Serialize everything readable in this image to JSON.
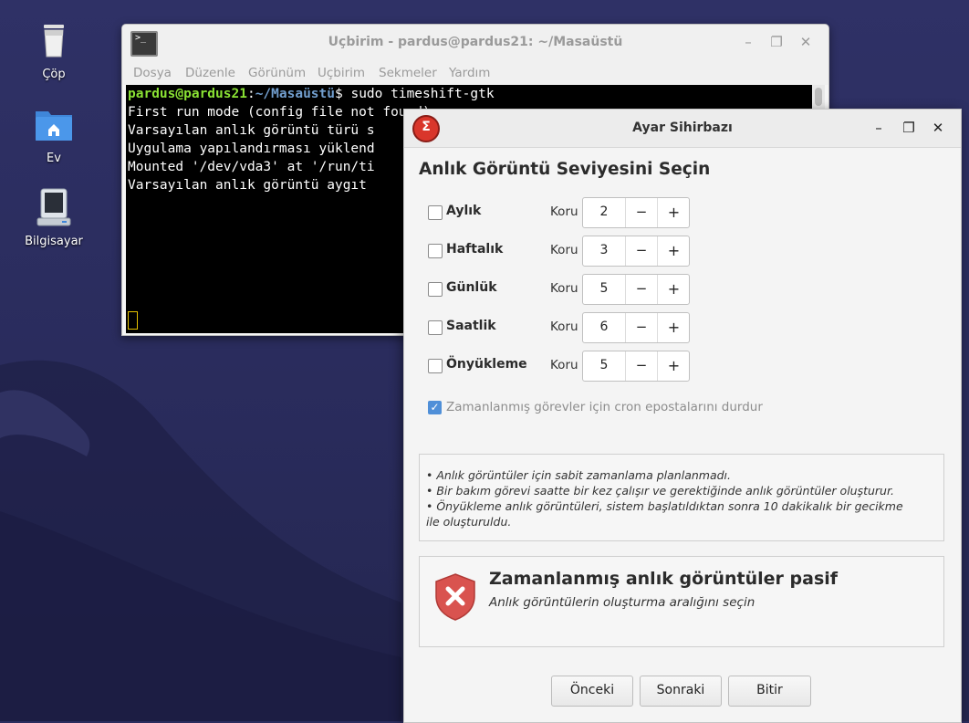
{
  "desktop": {
    "icons": [
      {
        "label": "Çöp",
        "icon": "trash-icon"
      },
      {
        "label": "Ev",
        "icon": "home-folder-icon"
      },
      {
        "label": "Bilgisayar",
        "icon": "computer-icon"
      }
    ]
  },
  "terminal": {
    "title": "Uçbirim - pardus@pardus21: ~/Masaüstü",
    "menu": [
      "Dosya",
      "Düzenle",
      "Görünüm",
      "Uçbirim",
      "Sekmeler",
      "Yardım"
    ],
    "prompt_user": "pardus@pardus21",
    "prompt_sep": ":",
    "prompt_path": "~/Masaüstü",
    "prompt_cmd": "$ sudo timeshift-gtk",
    "lines": [
      "First run mode (config file not found)",
      "Varsayılan anlık görüntü türü s",
      "Uygulama yapılandırması yüklend",
      "Mounted '/dev/vda3' at '/run/ti",
      "Varsayılan anlık görüntü aygıt"
    ]
  },
  "wizard": {
    "title": "Ayar Sihirbazı",
    "heading": "Anlık Görüntü Seviyesini Seçin",
    "keep_label": "Koru",
    "minus_glyph": "−",
    "plus_glyph": "+",
    "levels": [
      {
        "name": "Aylık",
        "value": "2",
        "checked": false
      },
      {
        "name": "Haftalık",
        "value": "3",
        "checked": false
      },
      {
        "name": "Günlük",
        "value": "5",
        "checked": false
      },
      {
        "name": "Saatlik",
        "value": "6",
        "checked": false
      },
      {
        "name": "Önyükleme",
        "value": "5",
        "checked": false
      }
    ],
    "cron_label": "Zamanlanmış görevler için cron epostalarını durdur",
    "cron_checked": true,
    "info_lines": [
      "• Anlık görüntüler için sabit zamanlama planlanmadı.",
      "• Bir bakım görevi saatte bir kez çalışır ve gerektiğinde anlık görüntüler oluşturur.",
      "• Önyükleme anlık görüntüleri, sistem başlatıldıktan sonra 10 dakikalık bir gecikme",
      "ile oluşturuldu."
    ],
    "status_title": "Zamanlanmış anlık görüntüler pasif",
    "status_subtitle": "Anlık görüntülerin oluşturma aralığını seçin",
    "buttons": {
      "prev": "Önceki",
      "next": "Sonraki",
      "finish": "Bitir"
    },
    "colors": {
      "accent": "#4f8fd8",
      "danger": "#d9534f"
    }
  }
}
